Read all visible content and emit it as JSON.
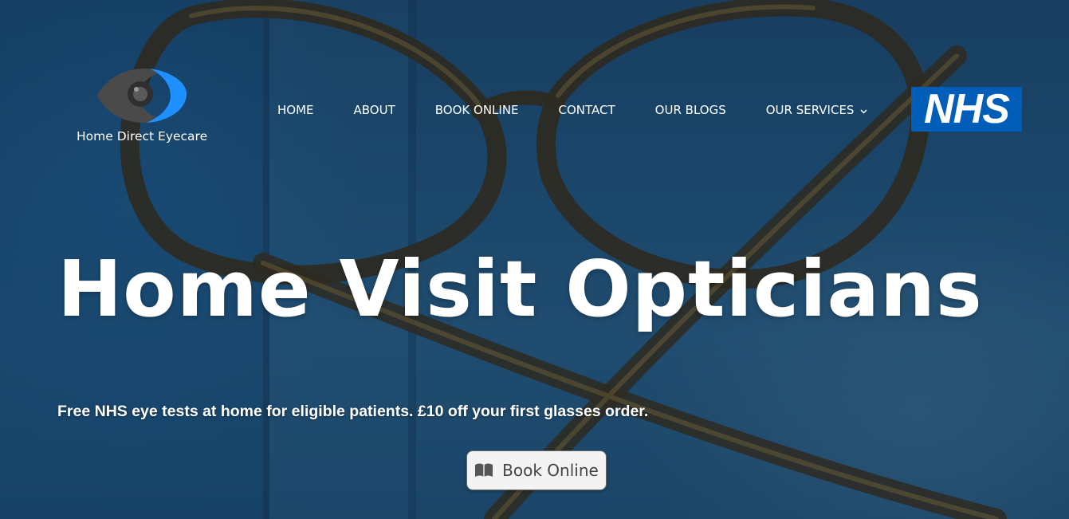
{
  "brand": {
    "name": "Home Direct Eyecare",
    "icon": "eye-logo-icon",
    "colors": {
      "iris_blue": "#1e90ff",
      "dark_grey": "#4a4a4a"
    }
  },
  "nav": {
    "items": [
      {
        "label": "HOME"
      },
      {
        "label": "ABOUT"
      },
      {
        "label": "BOOK ONLINE"
      },
      {
        "label": "CONTACT"
      },
      {
        "label": "OUR BLOGS"
      },
      {
        "label": "OUR SERVICES",
        "dropdown_icon": "chevron-down-icon"
      }
    ]
  },
  "nhs": {
    "text": "NHS",
    "color": "#005eb8"
  },
  "hero": {
    "title": "Home Visit Opticians",
    "subtitle": "Free NHS eye tests at home for eligible patients. £10 off your first glasses order.",
    "cta": {
      "label": "Book Online",
      "icon": "book-icon"
    }
  }
}
